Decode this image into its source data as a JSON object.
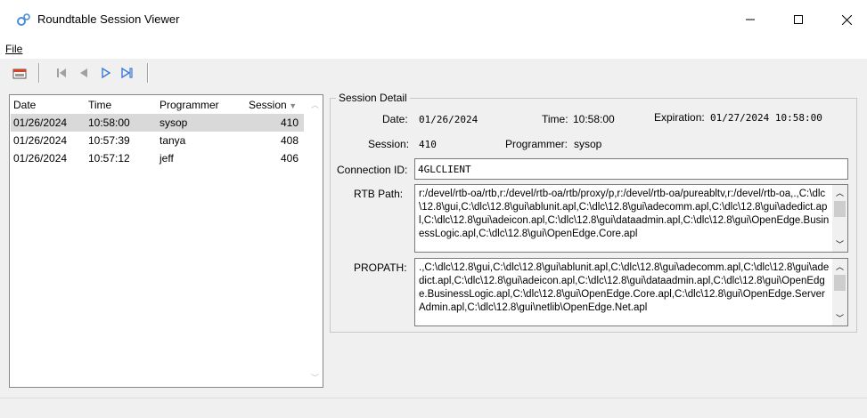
{
  "window": {
    "title": "Roundtable Session Viewer"
  },
  "menu": {
    "file_label": "File"
  },
  "list": {
    "columns": [
      "Date",
      "Time",
      "Programmer",
      "Session"
    ],
    "rows": [
      {
        "date": "01/26/2024",
        "time": "10:58:00",
        "programmer": "sysop",
        "session": "410"
      },
      {
        "date": "01/26/2024",
        "time": "10:57:39",
        "programmer": "tanya",
        "session": "408"
      },
      {
        "date": "01/26/2024",
        "time": "10:57:12",
        "programmer": "jeff",
        "session": "406"
      }
    ]
  },
  "detail": {
    "group_title": "Session Detail",
    "date_label": "Date:",
    "date_value": "01/26/2024",
    "time_label": "Time:",
    "time_value": "10:58:00",
    "expiration_label": "Expiration:",
    "expiration_value": "01/27/2024 10:58:00",
    "session_label": "Session:",
    "session_value": "410",
    "programmer_label": "Programmer:",
    "programmer_value": "sysop",
    "connection_label": "Connection ID:",
    "connection_value": "4GLCLIENT",
    "rtbpath_label": "RTB Path:",
    "rtbpath_value": "r:/devel/rtb-oa/rtb,r:/devel/rtb-oa/rtb/proxy/p,r:/devel/rtb-oa/pureabltv,r:/devel/rtb-oa,.,C:\\dlc\\12.8\\gui,C:\\dlc\\12.8\\gui\\ablunit.apl,C:\\dlc\\12.8\\gui\\adecomm.apl,C:\\dlc\\12.8\\gui\\adedict.apl,C:\\dlc\\12.8\\gui\\adeicon.apl,C:\\dlc\\12.8\\gui\\dataadmin.apl,C:\\dlc\\12.8\\gui\\OpenEdge.BusinessLogic.apl,C:\\dlc\\12.8\\gui\\OpenEdge.Core.apl",
    "propath_label": "PROPATH:",
    "propath_value": ".,C:\\dlc\\12.8\\gui,C:\\dlc\\12.8\\gui\\ablunit.apl,C:\\dlc\\12.8\\gui\\adecomm.apl,C:\\dlc\\12.8\\gui\\adedict.apl,C:\\dlc\\12.8\\gui\\adeicon.apl,C:\\dlc\\12.8\\gui\\dataadmin.apl,C:\\dlc\\12.8\\gui\\OpenEdge.BusinessLogic.apl,C:\\dlc\\12.8\\gui\\OpenEdge.Core.apl,C:\\dlc\\12.8\\gui\\OpenEdge.ServerAdmin.apl,C:\\dlc\\12.8\\gui\\netlib\\OpenEdge.Net.apl"
  },
  "icons": {
    "app": "gears-icon",
    "save": "save-icon",
    "first": "first-record-icon",
    "prev": "prev-record-icon",
    "next": "next-record-icon",
    "last": "last-record-icon"
  },
  "colors": {
    "selected_row": "#d9d9d9",
    "nav_blue": "#3c78d8",
    "nav_gray": "#a0a0a0"
  }
}
